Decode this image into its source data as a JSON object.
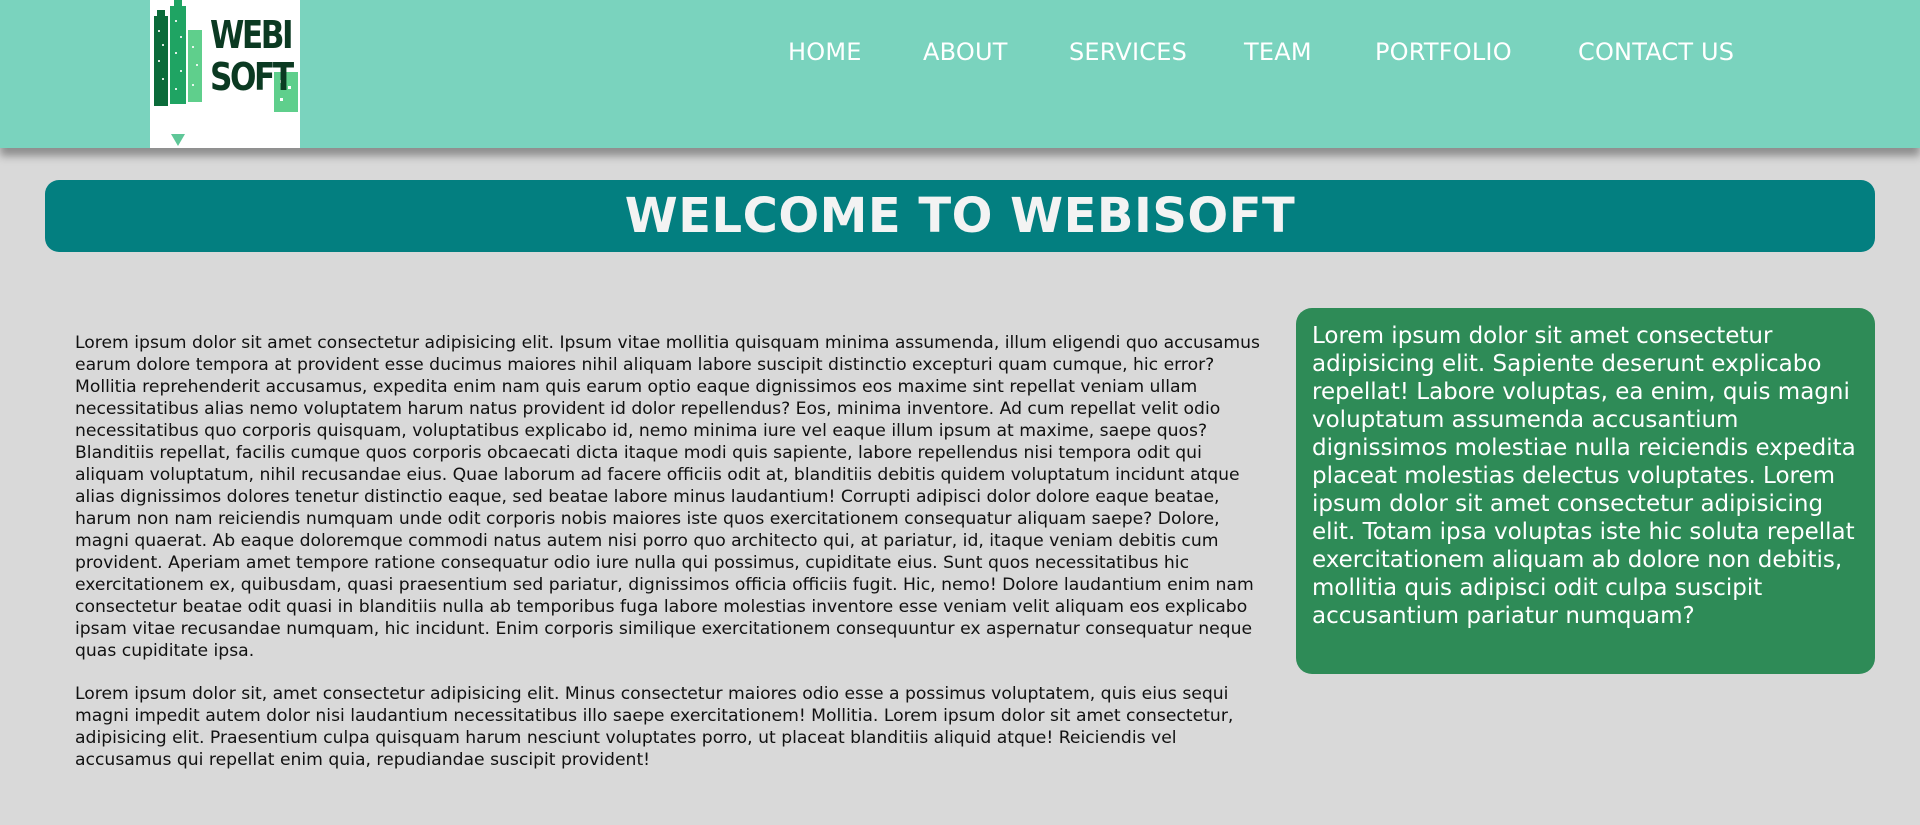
{
  "logo": {
    "text_line1": "WEBI",
    "text_line2": "SOFT",
    "icon": "buildings-logo-icon",
    "colors": {
      "dark_green": "#0b6b3a",
      "mid_green": "#1fa463",
      "light_green": "#5fcf8c"
    }
  },
  "nav": {
    "items": [
      {
        "label": "HOME"
      },
      {
        "label": "ABOUT"
      },
      {
        "label": "SERVICES"
      },
      {
        "label": "TEAM"
      },
      {
        "label": "PORTFOLIO"
      },
      {
        "label": "CONTACT US"
      }
    ]
  },
  "banner": {
    "title": "WELCOME TO WEBISOFT"
  },
  "main": {
    "paragraphs": [
      "Lorem ipsum dolor sit amet consectetur adipisicing elit. Ipsum vitae mollitia quisquam minima assumenda, illum eligendi quo accusamus earum dolore tempora at provident esse ducimus maiores nihil aliquam labore suscipit distinctio excepturi quam cumque, hic error? Mollitia reprehenderit accusamus, expedita enim nam quis earum optio eaque dignissimos eos maxime sint repellat veniam ullam necessitatibus alias nemo voluptatem harum natus provident id dolor repellendus? Eos, minima inventore. Ad cum repellat velit odio necessitatibus quo corporis quisquam, voluptatibus explicabo id, nemo minima iure vel eaque illum ipsum at maxime, saepe quos? Blanditiis repellat, facilis cumque quos corporis obcaecati dicta itaque modi quis sapiente, labore repellendus nisi tempora odit qui aliquam voluptatum, nihil recusandae eius. Quae laborum ad facere officiis odit at, blanditiis debitis quidem voluptatum incidunt atque alias dignissimos dolores tenetur distinctio eaque, sed beatae labore minus laudantium! Corrupti adipisci dolor dolore eaque beatae, harum non nam reiciendis numquam unde odit corporis nobis maiores iste quos exercitationem consequatur aliquam saepe? Dolore, magni quaerat. Ab eaque doloremque commodi natus autem nisi porro quo architecto qui, at pariatur, id, itaque veniam debitis cum provident. Aperiam amet tempore ratione consequatur odio iure nulla qui possimus, cupiditate eius. Sunt quos necessitatibus hic exercitationem ex, quibusdam, quasi praesentium sed pariatur, dignissimos officia officiis fugit. Hic, nemo! Dolore laudantium enim nam consectetur beatae odit quasi in blanditiis nulla ab temporibus fuga labore molestias inventore esse veniam velit aliquam eos explicabo ipsam vitae recusandae numquam, hic incidunt. Enim corporis similique exercitationem consequuntur ex aspernatur consequatur neque quas cupiditate ipsa.",
      "Lorem ipsum dolor sit, amet consectetur adipisicing elit. Minus consectetur maiores odio esse a possimus voluptatem, quis eius sequi magni impedit autem dolor nisi laudantium necessitatibus illo saepe exercitationem! Mollitia. Lorem ipsum dolor sit amet consectetur, adipisicing elit. Praesentium culpa quisquam harum nesciunt voluptates porro, ut placeat blanditiis aliquid atque! Reiciendis vel accusamus qui repellat enim quia, repudiandae suscipit provident!"
    ]
  },
  "aside": {
    "text": "Lorem ipsum dolor sit amet consectetur adipisicing elit. Sapiente deserunt explicabo repellat! Labore voluptas, ea enim, quis magni voluptatum assumenda accusantium dignissimos molestiae nulla reiciendis expedita placeat molestias delectus voluptates. Lorem ipsum dolor sit amet consectetur adipisicing elit. Totam ipsa voluptas iste hic soluta repellat exercitationem aliquam ab dolore non debitis, mollitia quis adipisci odit culpa suscipit accusantium pariatur numquam?"
  },
  "colors": {
    "header_bg": "#7ad3be",
    "banner_bg": "#037f80",
    "aside_bg": "#2e8b57",
    "page_bg": "#d9d9d9"
  }
}
